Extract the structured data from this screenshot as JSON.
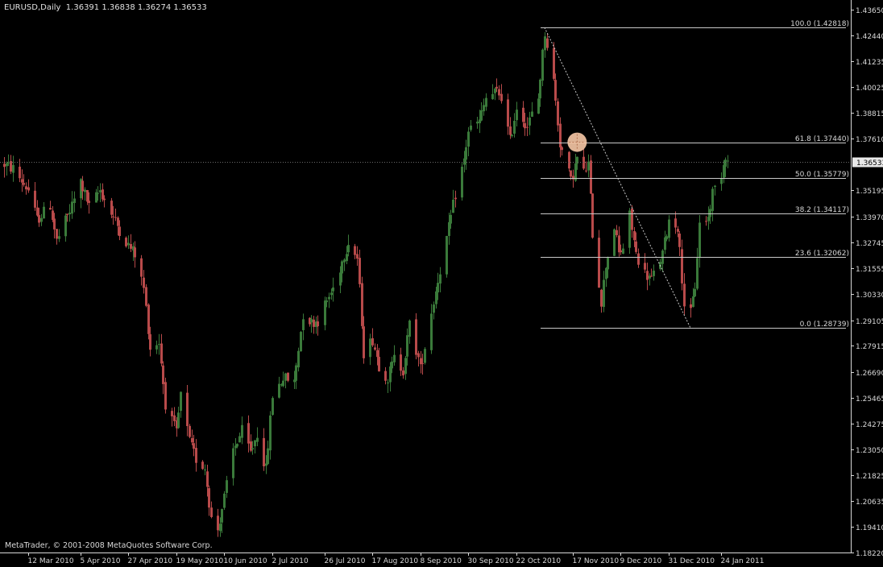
{
  "header": {
    "symbol": "EURUSD,Daily",
    "ohlc": "1.36391 1.36838 1.36274 1.36533"
  },
  "footer": {
    "copyright": "MetaTrader, © 2001-2008 MetaQuotes Software Corp."
  },
  "colors": {
    "background": "#000000",
    "bull": "#3a7a3a",
    "bear": "#b84a4a",
    "fib_line": "#c8c8c8",
    "axis": "#d8d8d8",
    "marker": "#f7c8a6"
  },
  "chart_data": {
    "type": "candlestick",
    "price_axis_ticks": [
      "1.43650",
      "1.42440",
      "1.41235",
      "1.40025",
      "1.38815",
      "1.37610",
      "1.36533",
      "1.35195",
      "1.33970",
      "1.32745",
      "1.31555",
      "1.30330",
      "1.29105",
      "1.27915",
      "1.26690",
      "1.25465",
      "1.24275",
      "1.23050",
      "1.21825",
      "1.20635",
      "1.19410",
      "1.18220"
    ],
    "current_price_label": "1.36533",
    "date_axis_ticks": [
      "12 Mar 2010",
      "5 Apr 2010",
      "27 Apr 2010",
      "19 May 2010",
      "10 Jun 2010",
      "2 Jul 2010",
      "26 Jul 2010",
      "17 Aug 2010",
      "8 Sep 2010",
      "30 Sep 2010",
      "22 Oct 2010",
      "17 Nov 2010",
      "9 Dec 2010",
      "31 Dec 2010",
      "24 Jan 2011"
    ],
    "ylim": [
      1.1822,
      1.4365
    ],
    "fibonacci": {
      "levels": [
        {
          "label": "100.0 (1.42818)",
          "price": 1.42818
        },
        {
          "label": "61.8 (1.37440)",
          "price": 1.3744
        },
        {
          "label": "50.0 (1.35779)",
          "price": 1.35779
        },
        {
          "label": "38.2 (1.34117)",
          "price": 1.34117
        },
        {
          "label": "23.6 (1.32062)",
          "price": 1.32062
        },
        {
          "label": "0.0 (1.28739)",
          "price": 1.28739
        }
      ],
      "high": 1.42818,
      "low": 1.28739,
      "high_date": "2010-11-04",
      "low_date": "2011-01-10"
    },
    "highlight_price": 1.3744,
    "close_path": [
      [
        "2010-03-01",
        1.364
      ],
      [
        "2010-03-05",
        1.362
      ],
      [
        "2010-03-12",
        1.352
      ],
      [
        "2010-03-16",
        1.338
      ],
      [
        "2010-03-22",
        1.345
      ],
      [
        "2010-03-25",
        1.328
      ],
      [
        "2010-03-31",
        1.342
      ],
      [
        "2010-04-05",
        1.356
      ],
      [
        "2010-04-09",
        1.344
      ],
      [
        "2010-04-14",
        1.352
      ],
      [
        "2010-04-20",
        1.339
      ],
      [
        "2010-04-27",
        1.326
      ],
      [
        "2010-04-30",
        1.322
      ],
      [
        "2010-05-04",
        1.306
      ],
      [
        "2010-05-07",
        1.278
      ],
      [
        "2010-05-11",
        1.281
      ],
      [
        "2010-05-14",
        1.252
      ],
      [
        "2010-05-19",
        1.238
      ],
      [
        "2010-05-21",
        1.256
      ],
      [
        "2010-05-25",
        1.234
      ],
      [
        "2010-05-28",
        1.226
      ],
      [
        "2010-06-01",
        1.222
      ],
      [
        "2010-06-04",
        1.198
      ],
      [
        "2010-06-07",
        1.193
      ],
      [
        "2010-06-10",
        1.208
      ],
      [
        "2010-06-14",
        1.23
      ],
      [
        "2010-06-18",
        1.239
      ],
      [
        "2010-06-22",
        1.229
      ],
      [
        "2010-06-25",
        1.238
      ],
      [
        "2010-06-29",
        1.221
      ],
      [
        "2010-07-02",
        1.256
      ],
      [
        "2010-07-07",
        1.264
      ],
      [
        "2010-07-12",
        1.262
      ],
      [
        "2010-07-16",
        1.294
      ],
      [
        "2010-07-20",
        1.29
      ],
      [
        "2010-07-23",
        1.291
      ],
      [
        "2010-07-26",
        1.298
      ],
      [
        "2010-07-30",
        1.306
      ],
      [
        "2010-08-04",
        1.322
      ],
      [
        "2010-08-06",
        1.328
      ],
      [
        "2010-08-10",
        1.32
      ],
      [
        "2010-08-13",
        1.276
      ],
      [
        "2010-08-17",
        1.282
      ],
      [
        "2010-08-20",
        1.27
      ],
      [
        "2010-08-24",
        1.264
      ],
      [
        "2010-08-27",
        1.273
      ],
      [
        "2010-08-31",
        1.268
      ],
      [
        "2010-09-03",
        1.289
      ],
      [
        "2010-09-07",
        1.273
      ],
      [
        "2010-09-08",
        1.268
      ],
      [
        "2010-09-13",
        1.295
      ],
      [
        "2010-09-16",
        1.31
      ],
      [
        "2010-09-21",
        1.334
      ],
      [
        "2010-09-24",
        1.35
      ],
      [
        "2010-09-28",
        1.366
      ],
      [
        "2010-09-30",
        1.38
      ],
      [
        "2010-10-05",
        1.384
      ],
      [
        "2010-10-08",
        1.395
      ],
      [
        "2010-10-13",
        1.398
      ],
      [
        "2010-10-15",
        1.396
      ],
      [
        "2010-10-19",
        1.375
      ],
      [
        "2010-10-22",
        1.391
      ],
      [
        "2010-10-27",
        1.382
      ],
      [
        "2010-11-01",
        1.395
      ],
      [
        "2010-11-04",
        1.426
      ],
      [
        "2010-11-08",
        1.403
      ],
      [
        "2010-11-11",
        1.374
      ],
      [
        "2010-11-16",
        1.356
      ],
      [
        "2010-11-19",
        1.367
      ],
      [
        "2010-11-22",
        1.36
      ],
      [
        "2010-11-24",
        1.364
      ],
      [
        "2010-11-26",
        1.332
      ],
      [
        "2010-11-30",
        1.3
      ],
      [
        "2010-12-02",
        1.317
      ],
      [
        "2010-12-06",
        1.335
      ],
      [
        "2010-12-08",
        1.322
      ],
      [
        "2010-12-10",
        1.325
      ],
      [
        "2010-12-13",
        1.34
      ],
      [
        "2010-12-16",
        1.322
      ],
      [
        "2010-12-20",
        1.313
      ],
      [
        "2010-12-23",
        1.31
      ],
      [
        "2010-12-28",
        1.322
      ],
      [
        "2010-12-31",
        1.338
      ],
      [
        "2011-01-04",
        1.335
      ],
      [
        "2011-01-07",
        1.299
      ],
      [
        "2011-01-10",
        1.294
      ],
      [
        "2011-01-12",
        1.307
      ],
      [
        "2011-01-14",
        1.336
      ],
      [
        "2011-01-18",
        1.339
      ],
      [
        "2011-01-20",
        1.351
      ],
      [
        "2011-01-24",
        1.36
      ],
      [
        "2011-01-26",
        1.369
      ],
      [
        "2011-01-27",
        1.365
      ]
    ]
  }
}
